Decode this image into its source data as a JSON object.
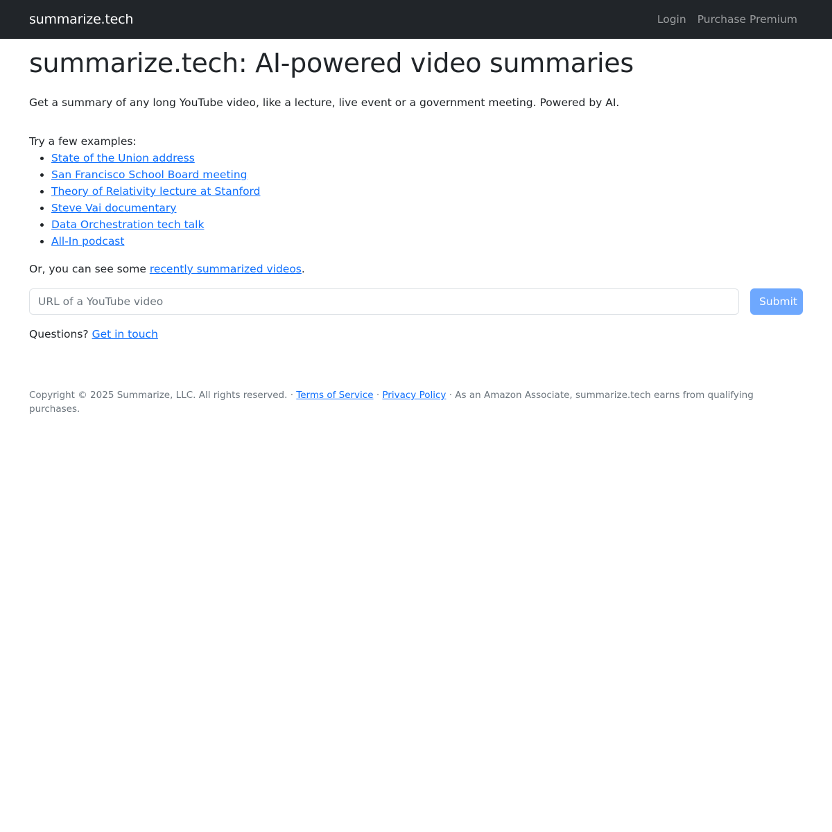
{
  "navbar": {
    "brand": "summarize.tech",
    "links": [
      "Login",
      "Purchase Premium"
    ]
  },
  "main": {
    "title": "summarize.tech: AI-powered video summaries",
    "intro": "Get a summary of any long YouTube video, like a lecture, live event or a government meeting. Powered by AI.",
    "examples_label": "Try a few examples:",
    "examples": [
      "State of the Union address",
      "San Francisco School Board meeting",
      "Theory of Relativity lecture at Stanford",
      "Steve Vai documentary",
      "Data Orchestration tech talk",
      "All-In podcast"
    ],
    "recent_prefix": "Or, you can see some ",
    "recent_link": "recently summarized videos",
    "recent_suffix": ".",
    "url_placeholder": "URL of a YouTube video",
    "submit_label": "Submit",
    "questions_prefix": "Questions? ",
    "questions_link": "Get in touch"
  },
  "footer": {
    "copyright": "Copyright © 2025 Summarize, LLC. All rights reserved. · ",
    "terms": "Terms of Service",
    "sep": " · ",
    "privacy": "Privacy Policy",
    "amazon": " · As an Amazon Associate, summarize.tech earns from qualifying purchases."
  },
  "colors": {
    "navbar_bg": "#212529",
    "link": "#0d6efd",
    "submit_bg": "#6ea8fe"
  }
}
